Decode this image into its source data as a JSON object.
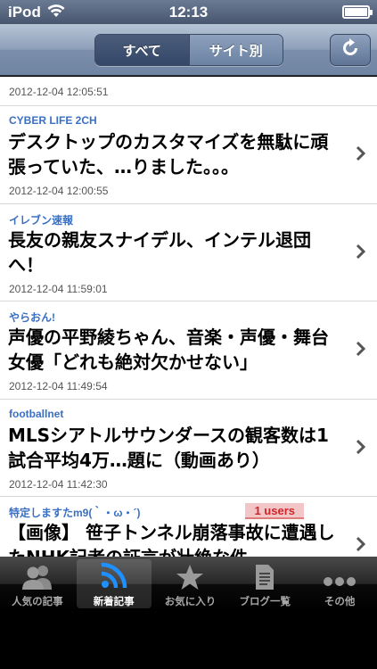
{
  "status_bar": {
    "carrier": "iPod",
    "time": "12:13"
  },
  "nav": {
    "segments": [
      "すべて",
      "サイト別"
    ],
    "selected_segment": "すべて",
    "refresh_icon": "refresh-icon"
  },
  "list": {
    "top_partial_date": "2012-12-04 12:05:51",
    "items": [
      {
        "source": "CYBER LIFE 2CH",
        "title": "デスクトップのカスタマイズを無駄に頑張っていた、…りました。。。",
        "date": "2012-12-04 12:00:55"
      },
      {
        "source": "イレブン速報",
        "title": "長友の親友スナイデル、インテル退団へ！",
        "date": "2012-12-04 11:59:01"
      },
      {
        "source": "やらおん!",
        "title": "声優の平野綾ちゃん、音楽・声優・舞台女優「どれも絶対欠かせない」",
        "date": "2012-12-04 11:49:54"
      },
      {
        "source": "footballnet",
        "title": "MLSシアトルサウンダースの観客数は1試合平均4万…題に（動画あり）",
        "date": "2012-12-04 11:42:30"
      },
      {
        "source": "特定しますたm9(｀・ω・´)",
        "badge": "1 users",
        "title": "【画像】 笹子トンネル崩落事故に遭遇したNHK記者の証言が壮絶な件"
      }
    ]
  },
  "tab_bar": {
    "tabs": [
      {
        "label": "人気の記事",
        "icon": "people-icon",
        "active": false
      },
      {
        "label": "新着記事",
        "icon": "rss-icon",
        "active": true
      },
      {
        "label": "お気に入り",
        "icon": "star-icon",
        "active": false
      },
      {
        "label": "ブログ一覧",
        "icon": "document-icon",
        "active": false
      },
      {
        "label": "その他",
        "icon": "more-icon",
        "active": false
      }
    ]
  },
  "colors": {
    "source_text": "#3a6fc4",
    "badge_text": "#d1252b",
    "badge_bg": "#f2c6c6"
  }
}
